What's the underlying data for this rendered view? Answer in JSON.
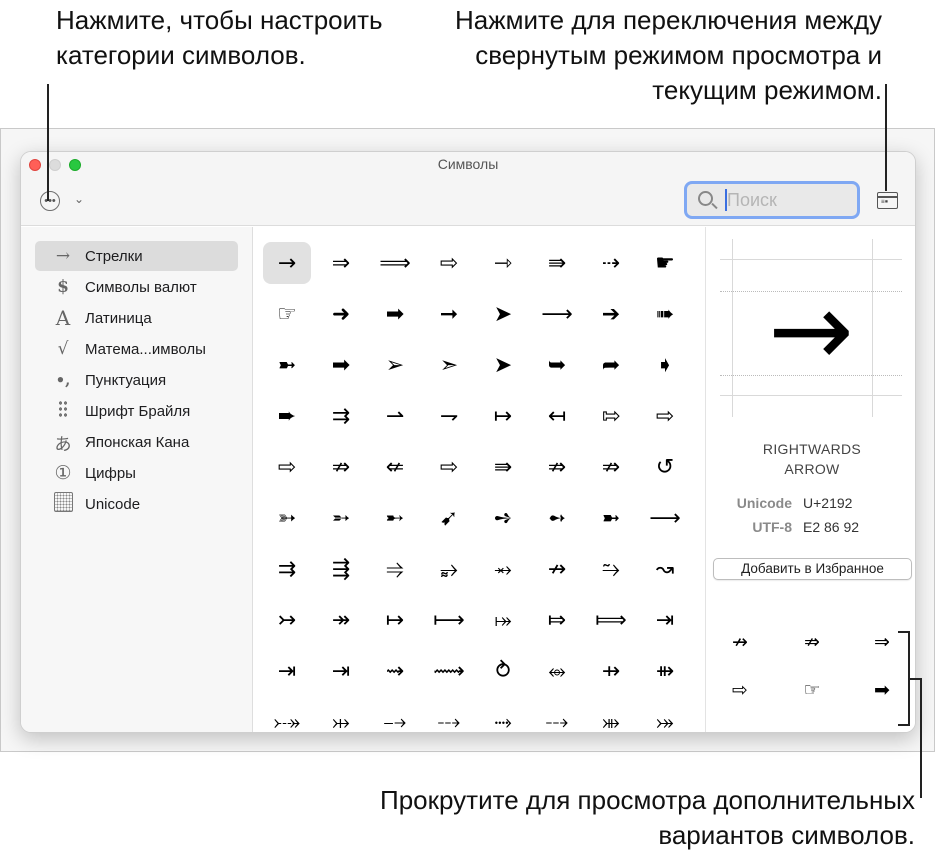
{
  "callouts": {
    "top_left": "Нажмите, чтобы настроить категории символов.",
    "top_right": "Нажмите для переключения между свернутым режимом просмотра и текущим режимом.",
    "bottom_right": "Прокрутите для просмотра дополнительных вариантов символов."
  },
  "window": {
    "title": "Символы",
    "more_icon": "ellipsis-circle-icon",
    "chevron": "⌄",
    "view_toggle_icon": "window-toggle-icon"
  },
  "search": {
    "placeholder": "Поиск",
    "value": ""
  },
  "sidebar": {
    "items": [
      {
        "icon": "→",
        "label": "Стрелки",
        "selected": true
      },
      {
        "icon": "$",
        "label": "Символы валют"
      },
      {
        "icon": "A",
        "label": "Латиница"
      },
      {
        "icon": "√",
        "label": "Матема...имволы"
      },
      {
        "icon": "•,",
        "label": "Пунктуация"
      },
      {
        "icon": "braille-icon",
        "label": "Шрифт Брайля"
      },
      {
        "icon": "あ",
        "label": "Японская Кана"
      },
      {
        "icon": "①",
        "label": "Цифры"
      },
      {
        "icon": "unicode-grid-icon",
        "label": "Unicode"
      }
    ]
  },
  "grid": {
    "selected_index": 0,
    "symbols": [
      "→",
      "⇒",
      "⟹",
      "⇨",
      "⇾",
      "⇛",
      "⇢",
      "☛",
      "☞",
      "➜",
      "➡",
      "➞",
      "➤",
      "⟶",
      "➔",
      "➠",
      "➼",
      "➡",
      "➢",
      "➣",
      "➤",
      "➥",
      "➦",
      "➧",
      "➨",
      "⇉",
      "⇀",
      "⇁",
      "↦",
      "↤",
      "⇰",
      "⇨",
      "⇨",
      "⇏",
      "⇍",
      "⇨",
      "⇛",
      "⇏",
      "⇏",
      "↺",
      "➳",
      "➵",
      "➸",
      "➹",
      "➺",
      "➻",
      "➼",
      "⟶",
      "⇉",
      "⇶",
      "⥤",
      "⥵",
      "⥇",
      "↛",
      "⥲",
      "↝",
      "↣",
      "↠",
      "↦",
      "⟼",
      "⤅",
      "⤇",
      "⟾",
      "⇥",
      "⇥",
      "⇥",
      "⇝",
      "⟿",
      "⥁",
      "⥈",
      "⇸",
      "⇻",
      "⤐",
      "⤔",
      "⤍",
      "⤏",
      "⤑",
      "⤏",
      "⤕",
      "⤖"
    ]
  },
  "inspector": {
    "preview_char": "→",
    "name_line1": "RIGHTWARDS",
    "name_line2": "ARROW",
    "unicode_label": "Unicode",
    "unicode_value": "U+2192",
    "utf8_label": "UTF-8",
    "utf8_value": "E2 86 92",
    "fav_button": "Добавить в Избранное",
    "variants": [
      "↛",
      "⇏",
      "⇒",
      "⇨",
      "☞",
      "➡"
    ]
  }
}
